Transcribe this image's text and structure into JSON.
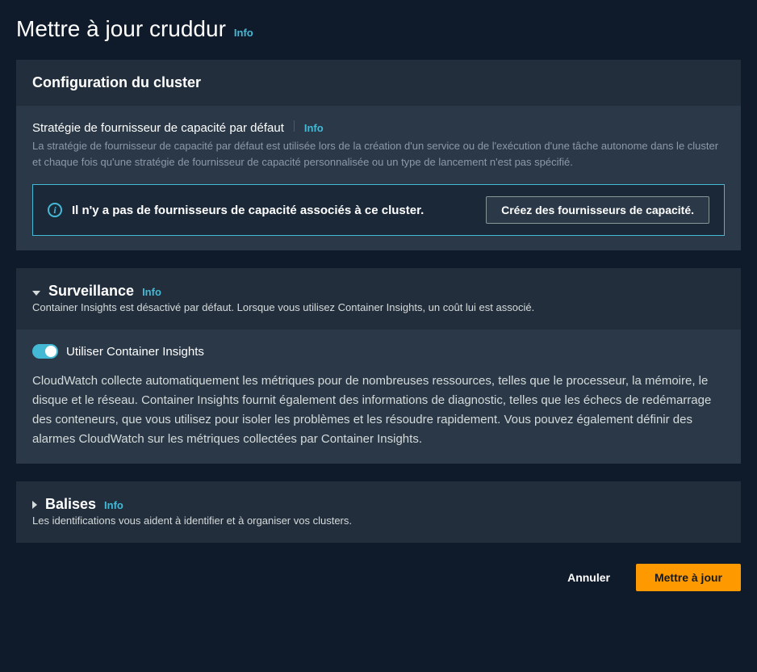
{
  "header": {
    "title": "Mettre à jour cruddur",
    "info": "Info"
  },
  "cluster_config": {
    "title": "Configuration du cluster",
    "capacity": {
      "title": "Stratégie de fournisseur de capacité par défaut",
      "info": "Info",
      "desc": "La stratégie de fournisseur de capacité par défaut est utilisée lors de la création d'un service ou de l'exécution d'une tâche autonome dans le cluster et chaque fois qu'une stratégie de fournisseur de capacité personnalisée ou un type de lancement n'est pas spécifié.",
      "alert_text": "Il n'y a pas de fournisseurs de capacité associés à ce cluster.",
      "create_btn": "Créez des fournisseurs de capacité."
    }
  },
  "surveillance": {
    "title": "Surveillance",
    "info": "Info",
    "desc": "Container Insights est désactivé par défaut. Lorsque vous utilisez Container Insights, un coût lui est associé.",
    "toggle_label": "Utiliser Container Insights",
    "toggle_on": true,
    "body": "CloudWatch collecte automatiquement les métriques pour de nombreuses ressources, telles que le processeur, la mémoire, le disque et le réseau. Container Insights fournit également des informations de diagnostic, telles que les échecs de redémarrage des conteneurs, que vous utilisez pour isoler les problèmes et les résoudre rapidement. Vous pouvez également définir des alarmes CloudWatch sur les métriques collectées par Container Insights."
  },
  "balises": {
    "title": "Balises",
    "info": "Info",
    "desc": "Les identifications vous aident à identifier et à organiser vos clusters."
  },
  "footer": {
    "cancel": "Annuler",
    "submit": "Mettre à jour"
  }
}
